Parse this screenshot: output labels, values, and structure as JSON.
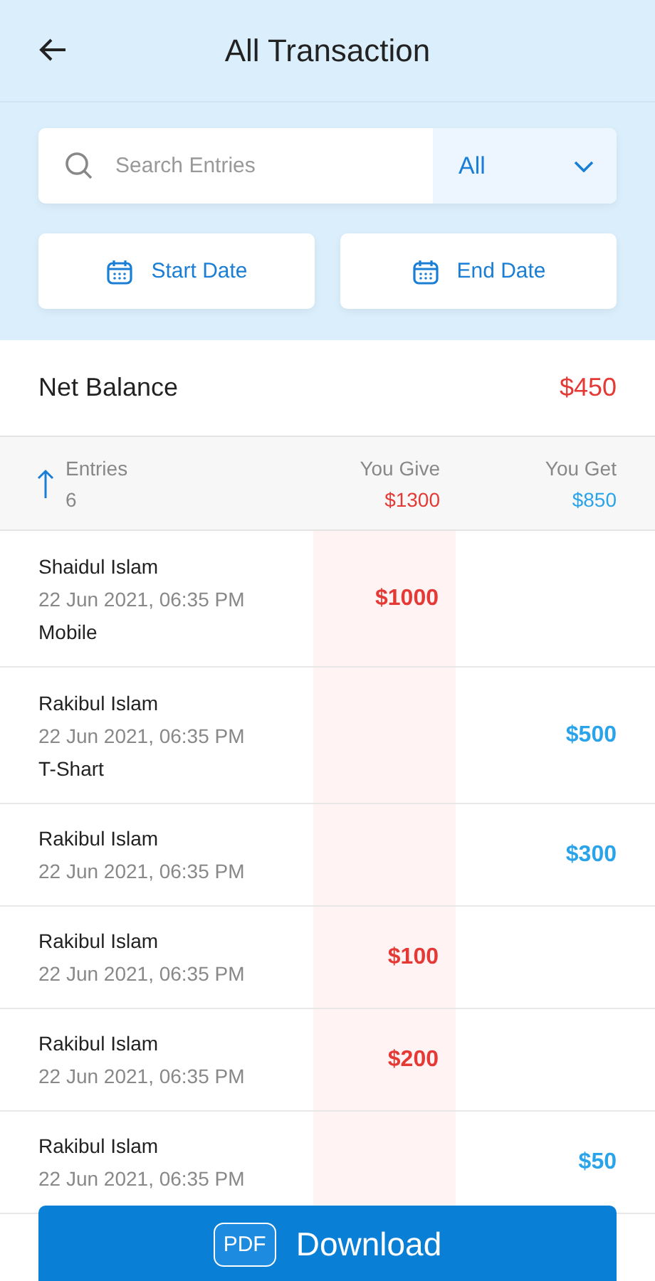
{
  "header": {
    "title": "All Transaction"
  },
  "search": {
    "placeholder": "Search Entries"
  },
  "filter": {
    "value": "All"
  },
  "date_buttons": [
    "Start Date",
    "End Date"
  ],
  "net_balance": {
    "label": "Net Balance",
    "amount": "$450"
  },
  "summary": {
    "entries_label": "Entries",
    "entries_count": "6",
    "give_label": "You Give",
    "give_total": "$1300",
    "get_label": "You Get",
    "get_total": "$850"
  },
  "transactions": [
    {
      "name": "Shaidul Islam",
      "date": "22 Jun 2021, 06:35 PM",
      "note": "Mobile",
      "kind": "give",
      "amount": "$1000"
    },
    {
      "name": "Rakibul Islam",
      "date": "22 Jun 2021, 06:35 PM",
      "note": "T-Shart",
      "kind": "get",
      "amount": "$500"
    },
    {
      "name": "Rakibul Islam",
      "date": "22 Jun 2021, 06:35 PM",
      "kind": "get",
      "amount": "$300"
    },
    {
      "name": "Rakibul Islam",
      "date": "22 Jun 2021, 06:35 PM",
      "kind": "give",
      "amount": "$100"
    },
    {
      "name": "Rakibul Islam",
      "date": "22 Jun 2021, 06:35 PM",
      "kind": "give",
      "amount": "$200"
    },
    {
      "name": "Rakibul Islam",
      "date": "22 Jun 2021, 06:35 PM",
      "kind": "get",
      "amount": "$50"
    }
  ],
  "download_button": {
    "badge": "PDF",
    "label": "Download"
  }
}
